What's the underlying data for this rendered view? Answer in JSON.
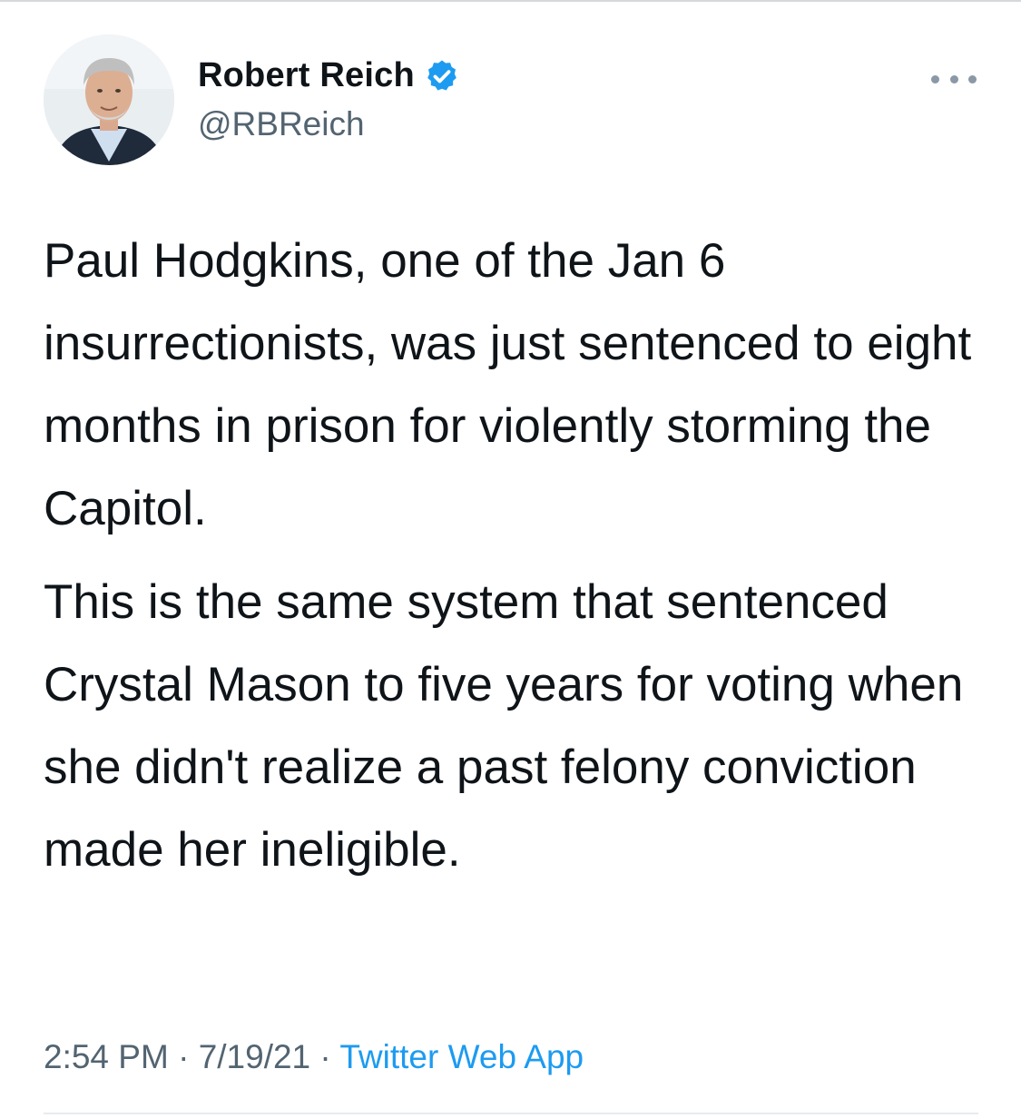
{
  "tweet": {
    "author": {
      "display_name": "Robert Reich",
      "handle": "@RBReich",
      "verified": true,
      "verified_color": "#1d9bf0"
    },
    "more_icon": "more-horizontal-icon",
    "paragraphs": [
      "Paul Hodgkins, one of the Jan 6 insurrectionists, was just sentenced to eight months in prison for violently storming the Capitol.",
      "This is the same system that sentenced Crystal Mason to five years for voting when she didn't realize a past felony conviction made her ineligible."
    ],
    "meta": {
      "time": "2:54 PM",
      "separator": "·",
      "date": "7/19/21",
      "source": "Twitter Web App"
    }
  },
  "colors": {
    "text": "#0f1419",
    "secondary": "#536471",
    "link": "#1d9bf0"
  }
}
